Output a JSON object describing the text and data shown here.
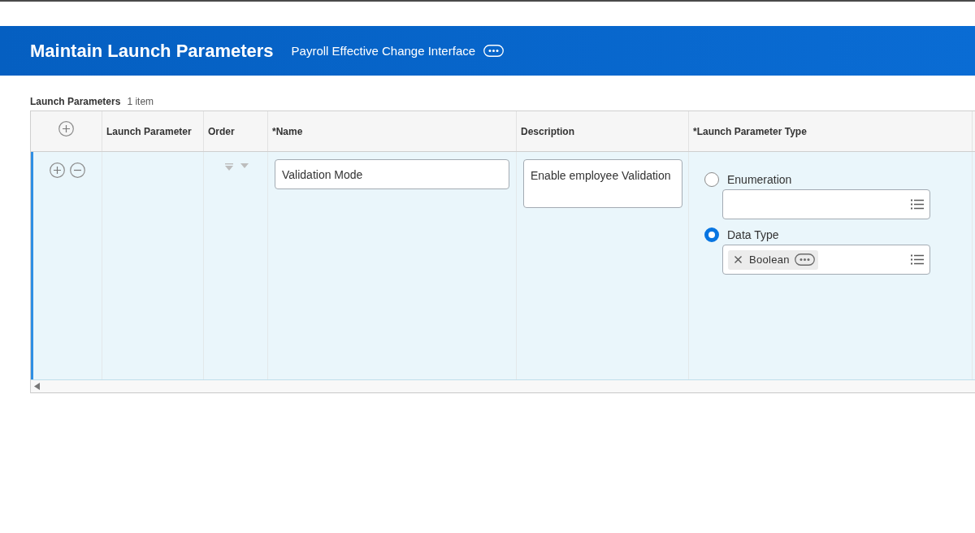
{
  "page": {
    "title": "Maintain Launch Parameters",
    "subtitle": "Payroll Effective Change Interface"
  },
  "grid": {
    "title": "Launch Parameters",
    "count": "1 item",
    "columns": [
      "Launch Parameter",
      "Order",
      "*Name",
      "Description",
      "*Launch Parameter Type"
    ],
    "rows": [
      {
        "selected": true,
        "name": "Validation Mode",
        "description": "Enable employee Validation",
        "type_options": [
          {
            "label": "Enumeration",
            "selected": false
          },
          {
            "label": "Data Type",
            "selected": true,
            "value": "Boolean"
          }
        ]
      }
    ]
  }
}
